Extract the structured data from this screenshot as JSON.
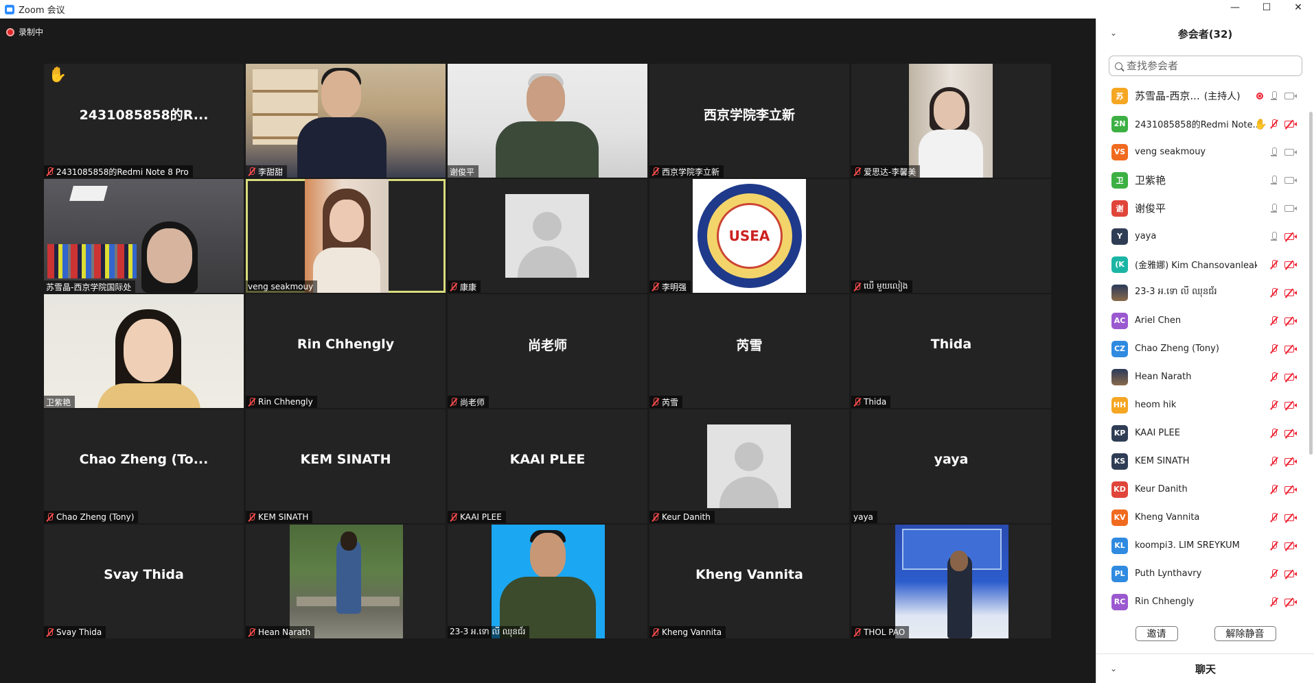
{
  "window": {
    "title": "Zoom 会议",
    "controls": {
      "minimize": "—",
      "maximize": "☐",
      "close": "✕"
    }
  },
  "recording": {
    "label": "录制中"
  },
  "tiles": [
    {
      "bigname": "2431085858的R...",
      "label": "2431085858的Redmi Note 8 Pro",
      "muted": true,
      "hand": true,
      "kind": "name"
    },
    {
      "label": "李甜甜",
      "muted": true,
      "kind": "office"
    },
    {
      "label": "谢俊平",
      "muted": false,
      "kind": "man"
    },
    {
      "bigname": "西京学院李立新",
      "label": "西京学院李立新",
      "muted": true,
      "kind": "name"
    },
    {
      "label": "爱思达-李馨美",
      "muted": true,
      "kind": "woman"
    },
    {
      "label": "苏雪晶-西京学院国际处",
      "muted": false,
      "kind": "room"
    },
    {
      "label": "veng seakmouy",
      "muted": false,
      "kind": "girl2",
      "active": true
    },
    {
      "label": "康康",
      "muted": true,
      "kind": "avatar"
    },
    {
      "label": "李明强",
      "muted": true,
      "kind": "logo",
      "logo_text": "USEA"
    },
    {
      "label": "ឃើ មួយលៀង",
      "muted": true,
      "kind": "blank"
    },
    {
      "label": "卫紫艳",
      "muted": false,
      "kind": "girl3"
    },
    {
      "bigname": "Rin Chhengly",
      "label": "Rin Chhengly",
      "muted": true,
      "kind": "name"
    },
    {
      "bigname": "尚老师",
      "label": "尚老师",
      "muted": true,
      "kind": "name"
    },
    {
      "bigname": "芮雪",
      "label": "芮雪",
      "muted": true,
      "kind": "name"
    },
    {
      "bigname": "Thida",
      "label": "Thida",
      "muted": true,
      "kind": "name"
    },
    {
      "bigname": "Chao Zheng (To...",
      "label": "Chao Zheng (Tony)",
      "muted": true,
      "kind": "name"
    },
    {
      "bigname": "KEM SINATH",
      "label": "KEM SINATH",
      "muted": true,
      "kind": "name"
    },
    {
      "bigname": "KAAI PLEE",
      "label": "KAAI PLEE",
      "muted": true,
      "kind": "name"
    },
    {
      "label": "Keur Danith",
      "muted": true,
      "kind": "avatar"
    },
    {
      "bigname": "yaya",
      "label": "yaya",
      "muted": false,
      "kind": "name"
    },
    {
      "bigname": "Svay Thida",
      "label": "Svay Thida",
      "muted": true,
      "kind": "name"
    },
    {
      "label": "Hean Narath",
      "muted": true,
      "kind": "garden"
    },
    {
      "label": "23-3 អ.ទោ លី ឈុនជ័រ",
      "muted": false,
      "kind": "soldier"
    },
    {
      "bigname": "Kheng Vannita",
      "label": "Kheng Vannita",
      "muted": true,
      "kind": "name"
    },
    {
      "label": "THOL PAO",
      "muted": true,
      "kind": "conf"
    }
  ],
  "panel": {
    "title": "参会者(32)",
    "search_placeholder": "查找参会者",
    "participants": [
      {
        "initials": "苏",
        "color": "#f5a623",
        "name": "苏雪晶-西京...",
        "host": "(主持人)",
        "big": true,
        "rec": true,
        "mic": "on",
        "cam": "on"
      },
      {
        "initials": "2N",
        "color": "#3cb043",
        "name": "2431085858的Redmi Note...",
        "hand": true,
        "mic": "off",
        "cam": "off"
      },
      {
        "initials": "VS",
        "color": "#f06a1f",
        "name": "veng seakmouy",
        "mic": "on",
        "cam": "on"
      },
      {
        "initials": "卫",
        "color": "#3cb043",
        "name": "卫紫艳",
        "big": true,
        "mic": "on",
        "cam": "on"
      },
      {
        "initials": "谢",
        "color": "#e0453a",
        "name": "谢俊平",
        "big": true,
        "mic": "on",
        "cam": "on"
      },
      {
        "initials": "Y",
        "color": "#2f3d54",
        "name": "yaya",
        "mic": "on",
        "cam": "off"
      },
      {
        "initials": "(K",
        "color": "#1bb5a5",
        "name": "(金雅娜) Kim Chansovanleakna",
        "mic": "off",
        "cam": "off"
      },
      {
        "initials": "",
        "color": "#2a3a5a",
        "photo": true,
        "name": "23-3 អ.ទោ លី ឈុនជ័រ",
        "mic": "off",
        "cam": "off"
      },
      {
        "initials": "AC",
        "color": "#9b59d0",
        "name": "Ariel Chen",
        "mic": "off",
        "cam": "off"
      },
      {
        "initials": "CZ",
        "color": "#2f8ae0",
        "name": "Chao Zheng (Tony)",
        "mic": "off",
        "cam": "off"
      },
      {
        "initials": "",
        "color": "#3a5a3a",
        "photo": true,
        "name": "Hean Narath",
        "mic": "off",
        "cam": "off"
      },
      {
        "initials": "HH",
        "color": "#f5a623",
        "name": "heom hik",
        "mic": "off",
        "cam": "off"
      },
      {
        "initials": "KP",
        "color": "#2f3d54",
        "name": "KAAI PLEE",
        "mic": "off",
        "cam": "off"
      },
      {
        "initials": "KS",
        "color": "#2f3d54",
        "name": "KEM SINATH",
        "mic": "off",
        "cam": "off"
      },
      {
        "initials": "KD",
        "color": "#e0453a",
        "name": "Keur Danith",
        "mic": "off",
        "cam": "off"
      },
      {
        "initials": "KV",
        "color": "#f06a1f",
        "name": "Kheng Vannita",
        "mic": "off",
        "cam": "off"
      },
      {
        "initials": "KL",
        "color": "#2f8ae0",
        "name": "koompi3. LIM SREYKUM",
        "mic": "off",
        "cam": "off"
      },
      {
        "initials": "PL",
        "color": "#2f8ae0",
        "name": "Puth Lynthavry",
        "mic": "off",
        "cam": "off"
      },
      {
        "initials": "RC",
        "color": "#9b59d0",
        "name": "Rin Chhengly",
        "mic": "off",
        "cam": "off"
      }
    ],
    "invite_label": "邀请",
    "unmute_label": "解除静音",
    "chat_label": "聊天"
  }
}
